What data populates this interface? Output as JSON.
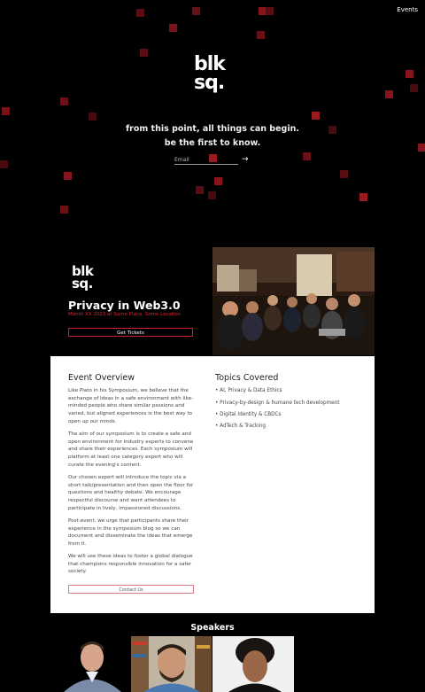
{
  "nav": {
    "events_label": "Events"
  },
  "hero": {
    "logo_line1": "blk",
    "logo_line2": "sq.",
    "tagline_line1": "from this point, all things can begin.",
    "tagline_line2": "be the first to know.",
    "email_placeholder": "Email",
    "submit_arrow": "→"
  },
  "event": {
    "logo_line1": "blk",
    "logo_line2": "sq.",
    "title": "Privacy in Web3.0",
    "subtitle": "Month XX 2023 at Some Place, Some Location",
    "tickets_label": "Get Tickets"
  },
  "overview": {
    "heading": "Event Overview",
    "paragraphs": [
      "Like Plato in his Symposium, we believe that the exchange of ideas in a safe environment with like-minded people who share similar passions and varied, but aligned experiences is the best way to open up our minds.",
      "The aim of our symposium is to create a safe and open environment for industry experts to convene and share their experiences. Each symposium will platform at least one category expert who will curate the evening's content.",
      "Our chosen expert will introduce the topic via a short talk/presentation and then open the floor for questions and healthy debate. We encourage respectful discourse and want attendees to participate in lively, impassioned discussions.",
      "Post-event, we urge that participants share their experience in the symposium blog so we can document and disseminate the ideas that emerge from it.",
      "We will use these ideas to foster a global dialogue that champions responsible innovation for a safer society."
    ],
    "contact_label": "Contact Us"
  },
  "topics": {
    "heading": "Topics Covered",
    "items": [
      "AI, Privacy & Data Ethics",
      "Privacy-by-design & humane tech development",
      "Digital Identity & CBDCs",
      "AdTech & Tracking"
    ]
  },
  "speakers": {
    "heading": "Speakers"
  },
  "colors": {
    "accent": "#d11f2a",
    "background": "#000000",
    "panel": "#ffffff"
  }
}
